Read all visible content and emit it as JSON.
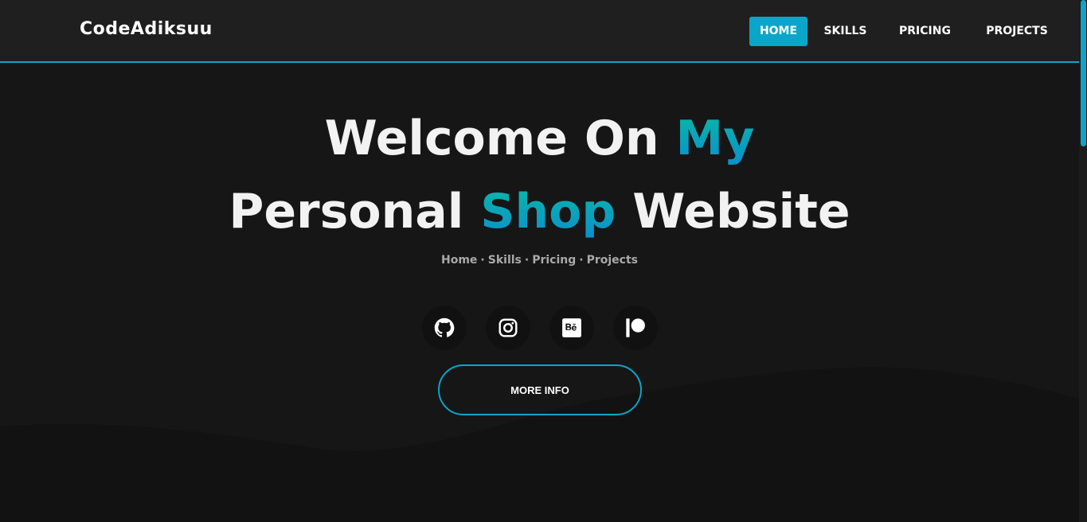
{
  "brand": "CodeAdiksuu",
  "nav": [
    {
      "label": "HOME",
      "active": true
    },
    {
      "label": "SKILLS",
      "active": false
    },
    {
      "label": "PRICING",
      "active": false
    },
    {
      "label": "PROJECTS",
      "active": false
    }
  ],
  "hero": {
    "line1": {
      "plain": "Welcome On ",
      "accent": "My"
    },
    "line2": {
      "plain1": "Personal ",
      "accent": "Shop",
      "plain2": " Website"
    },
    "crumbs": [
      "Home",
      "Skills",
      "Pricing",
      "Projects"
    ],
    "crumb_separator": "·",
    "socials": [
      {
        "icon": "github-icon"
      },
      {
        "icon": "instagram-icon"
      },
      {
        "icon": "behance-icon"
      },
      {
        "icon": "patreon-icon"
      }
    ],
    "button": "MORE INFO"
  },
  "colors": {
    "accent": "#0aa6c9",
    "background": "#161616",
    "navbar": "#1f1f1f"
  }
}
